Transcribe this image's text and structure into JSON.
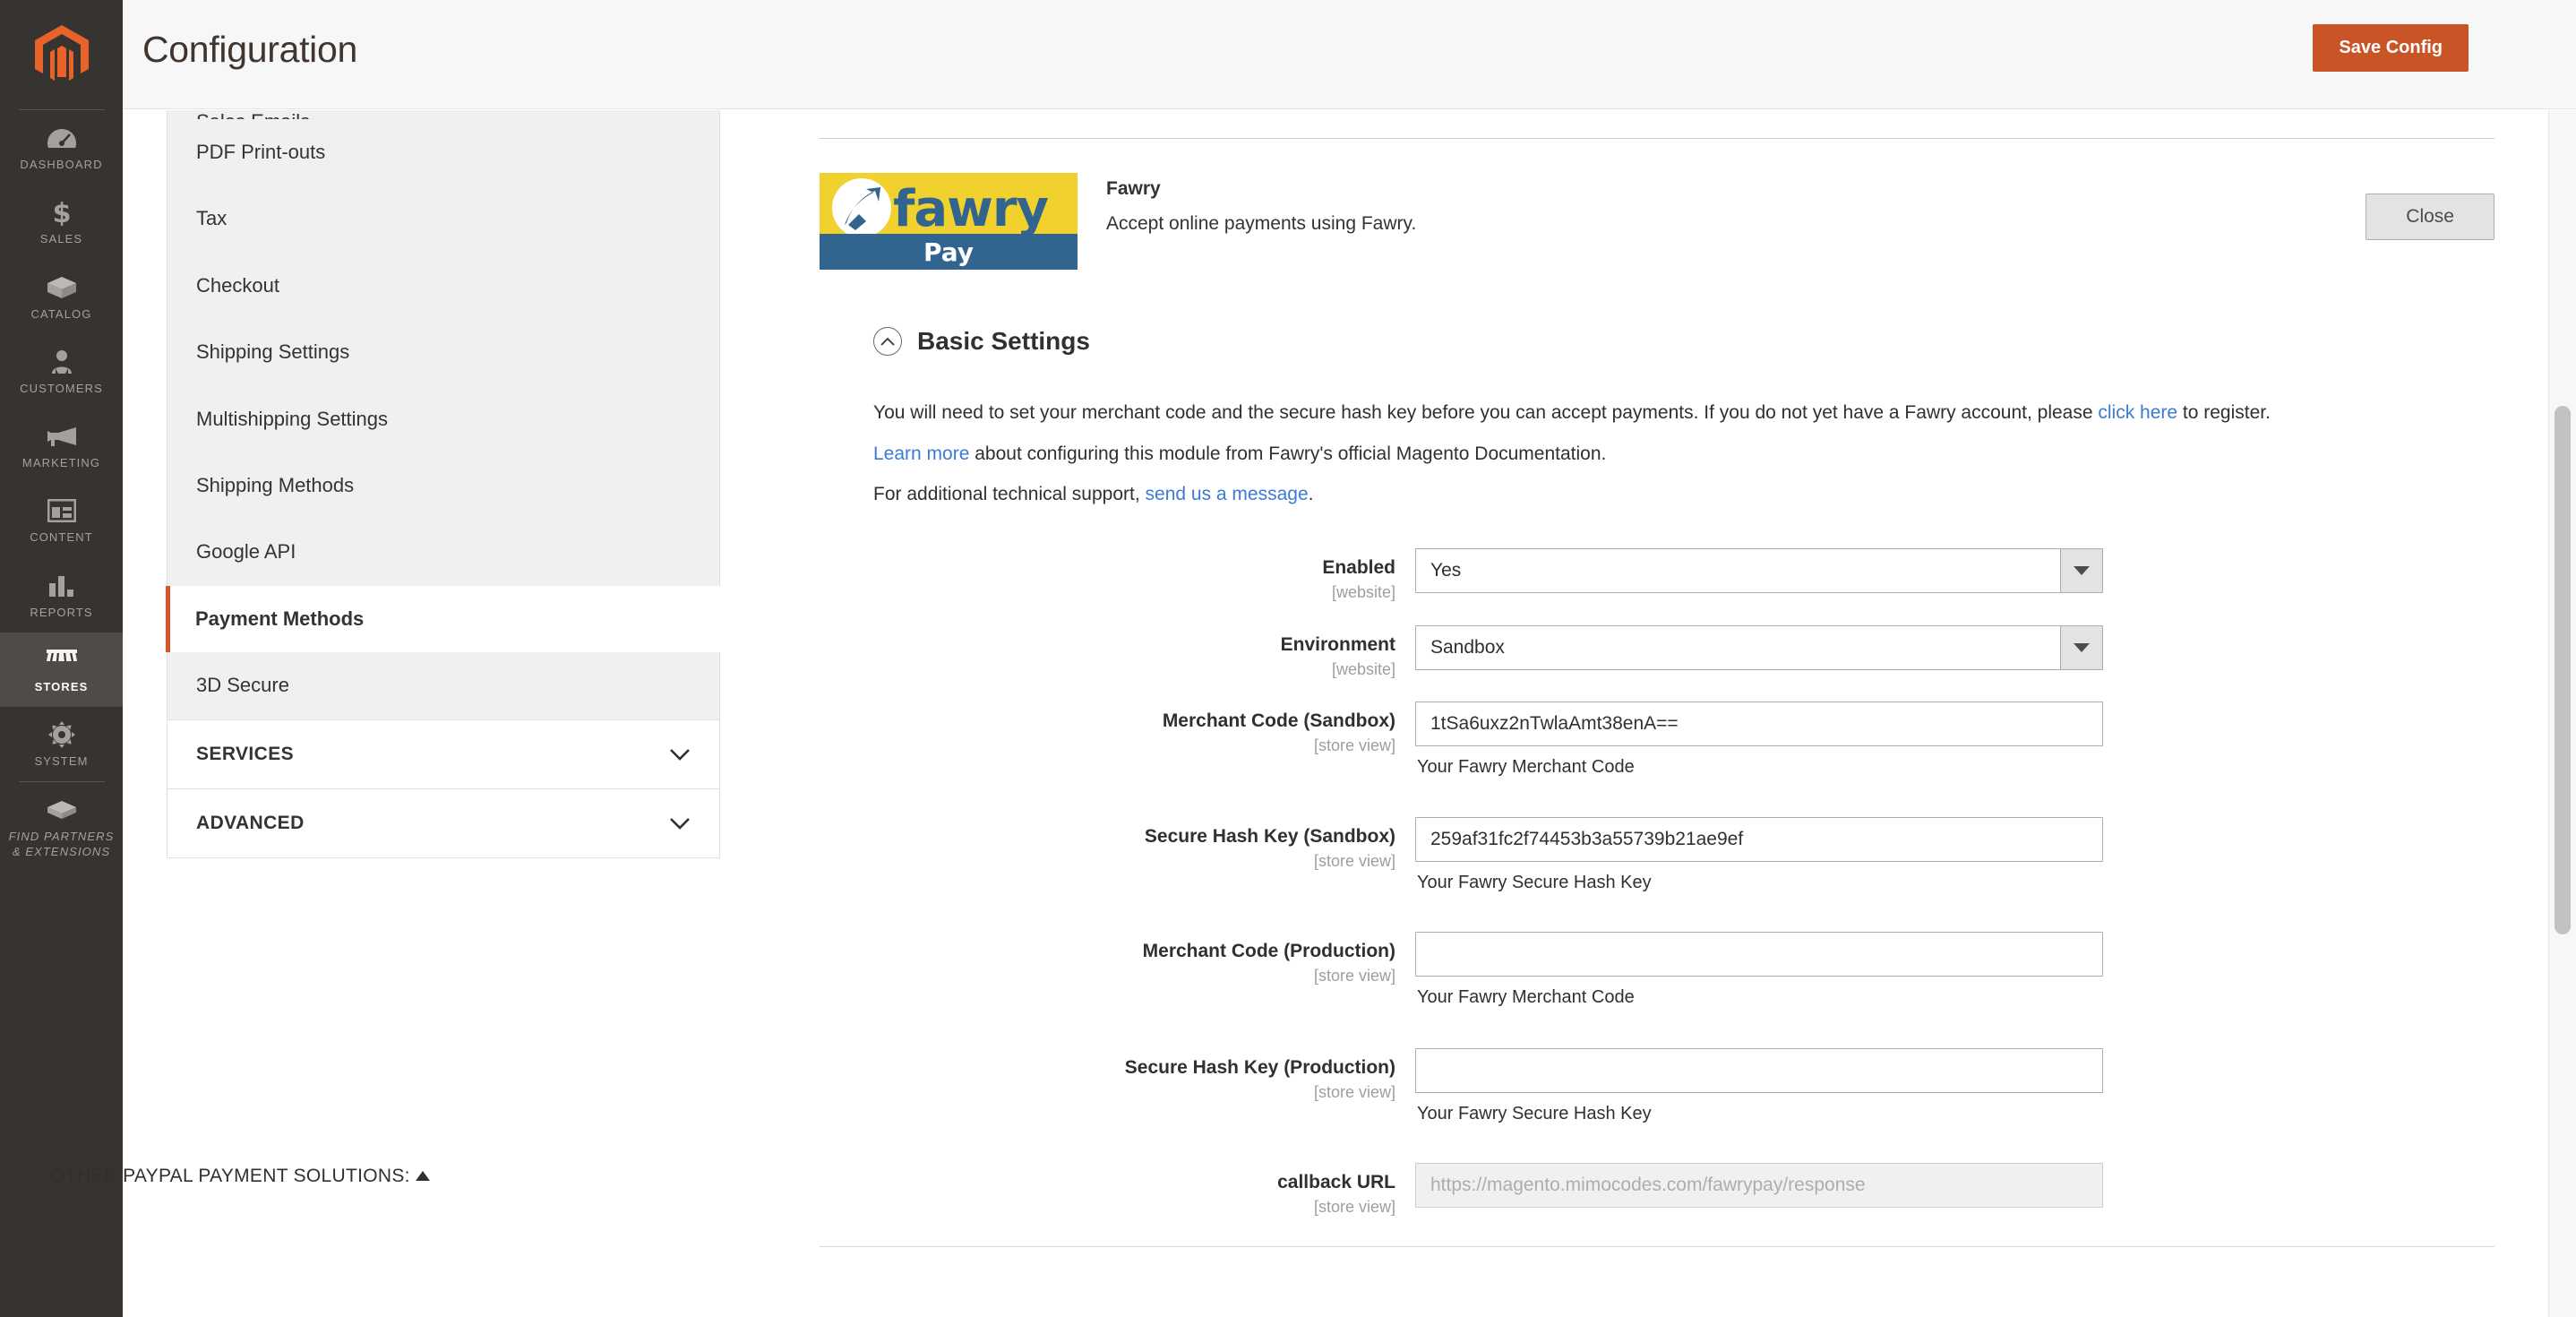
{
  "admin_nav": {
    "logo": "magento-logo",
    "items": [
      {
        "label": "DASHBOARD",
        "icon": "dashboard-icon",
        "active": false
      },
      {
        "label": "SALES",
        "icon": "dollar-icon",
        "active": false
      },
      {
        "label": "CATALOG",
        "icon": "box-icon",
        "active": false
      },
      {
        "label": "CUSTOMERS",
        "icon": "person-icon",
        "active": false
      },
      {
        "label": "MARKETING",
        "icon": "megaphone-icon",
        "active": false
      },
      {
        "label": "CONTENT",
        "icon": "layout-icon",
        "active": false
      },
      {
        "label": "REPORTS",
        "icon": "bar-chart-icon",
        "active": false
      },
      {
        "label": "STORES",
        "icon": "storefront-icon",
        "active": true
      },
      {
        "label": "SYSTEM",
        "icon": "gear-icon",
        "active": false
      },
      {
        "label": "FIND PARTNERS\n& EXTENSIONS",
        "icon": "partners-icon",
        "active": false
      }
    ]
  },
  "header": {
    "title": "Configuration",
    "save_label": "Save Config"
  },
  "config_sidebar": {
    "items": [
      {
        "label": "Sales Emails",
        "active": false,
        "cut": true
      },
      {
        "label": "PDF Print-outs",
        "active": false
      },
      {
        "label": "Tax",
        "active": false
      },
      {
        "label": "Checkout",
        "active": false
      },
      {
        "label": "Shipping Settings",
        "active": false
      },
      {
        "label": "Multishipping Settings",
        "active": false
      },
      {
        "label": "Shipping Methods",
        "active": false
      },
      {
        "label": "Google API",
        "active": false
      }
    ],
    "active_item": {
      "label": "Payment Methods"
    },
    "items_after": [
      {
        "label": "3D Secure",
        "active": false
      }
    ],
    "sections": [
      {
        "label": "SERVICES"
      },
      {
        "label": "ADVANCED"
      }
    ]
  },
  "method": {
    "logo_word": "fawry",
    "logo_pay": "Pay",
    "title": "Fawry",
    "description": "Accept online payments using Fawry.",
    "close_label": "Close"
  },
  "fieldset": {
    "legend": "Basic Settings",
    "intro": {
      "line1_a": "You will need to set your merchant code and the secure hash key before you can accept payments. If you do not yet have a Fawry account, please ",
      "line1_link": "click here",
      "line1_b": " to register.",
      "line2_link": "Learn more",
      "line2_b": " about configuring this module from Fawry's official Magento Documentation.",
      "line3_a": "For additional technical support, ",
      "line3_link": "send us a message",
      "line3_b": "."
    }
  },
  "fields": {
    "enabled": {
      "label": "Enabled",
      "scope": "[website]",
      "value": "Yes",
      "type": "select"
    },
    "environment": {
      "label": "Environment",
      "scope": "[website]",
      "value": "Sandbox",
      "type": "select"
    },
    "merchant_code_sandbox": {
      "label": "Merchant Code (Sandbox)",
      "scope": "[store view]",
      "value": "1tSa6uxz2nTwlaAmt38enA==",
      "note": "Your Fawry Merchant Code"
    },
    "secure_hash_sandbox": {
      "label": "Secure Hash Key (Sandbox)",
      "scope": "[store view]",
      "value": "259af31fc2f74453b3a55739b21ae9ef",
      "note": "Your Fawry Secure Hash Key"
    },
    "merchant_code_production": {
      "label": "Merchant Code (Production)",
      "scope": "[store view]",
      "value": "",
      "note": "Your Fawry Merchant Code"
    },
    "secure_hash_production": {
      "label": "Secure Hash Key (Production)",
      "scope": "[store view]",
      "value": "",
      "note": "Your Fawry Secure Hash Key"
    },
    "callback_url": {
      "label": "callback URL",
      "scope": "[store view]",
      "value": "",
      "placeholder": "https://magento.mimocodes.com/fawrypay/response"
    }
  },
  "footer": {
    "other_solutions": "OTHER PAYPAL PAYMENT SOLUTIONS:"
  },
  "colors": {
    "brand_orange": "#c95425",
    "active_accent": "#d4582a",
    "nav_dark": "#373330",
    "link_blue": "#3b7bd4",
    "fawry_yellow": "#f0d12e",
    "fawry_blue": "#31658f"
  }
}
